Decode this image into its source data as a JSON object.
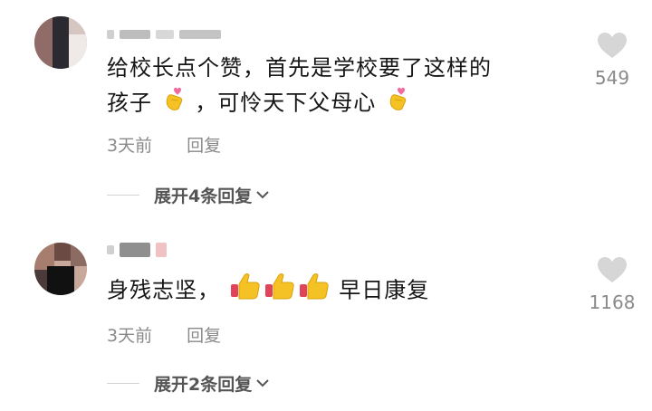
{
  "comments": [
    {
      "line1": "给校长点个赞，首先是学校要了这样的",
      "line2_a": "孩子",
      "line2_b": "，可怜天下父母心",
      "time": "3天前",
      "reply": "回复",
      "expand": "展开4条回复",
      "likes": "549",
      "emoji": "finger-heart-icon"
    },
    {
      "text_a": "身残志坚，",
      "text_b": "早日康复",
      "time": "3天前",
      "reply": "回复",
      "expand": "展开2条回复",
      "likes": "1168",
      "emoji": "thumbs-up-icon"
    }
  ],
  "colors": {
    "text": "#161616",
    "meta": "#8a8a8a",
    "heart": "#d6d6d6",
    "emoji_yellow": "#f5c226",
    "emoji_pink": "#f06ca0"
  }
}
